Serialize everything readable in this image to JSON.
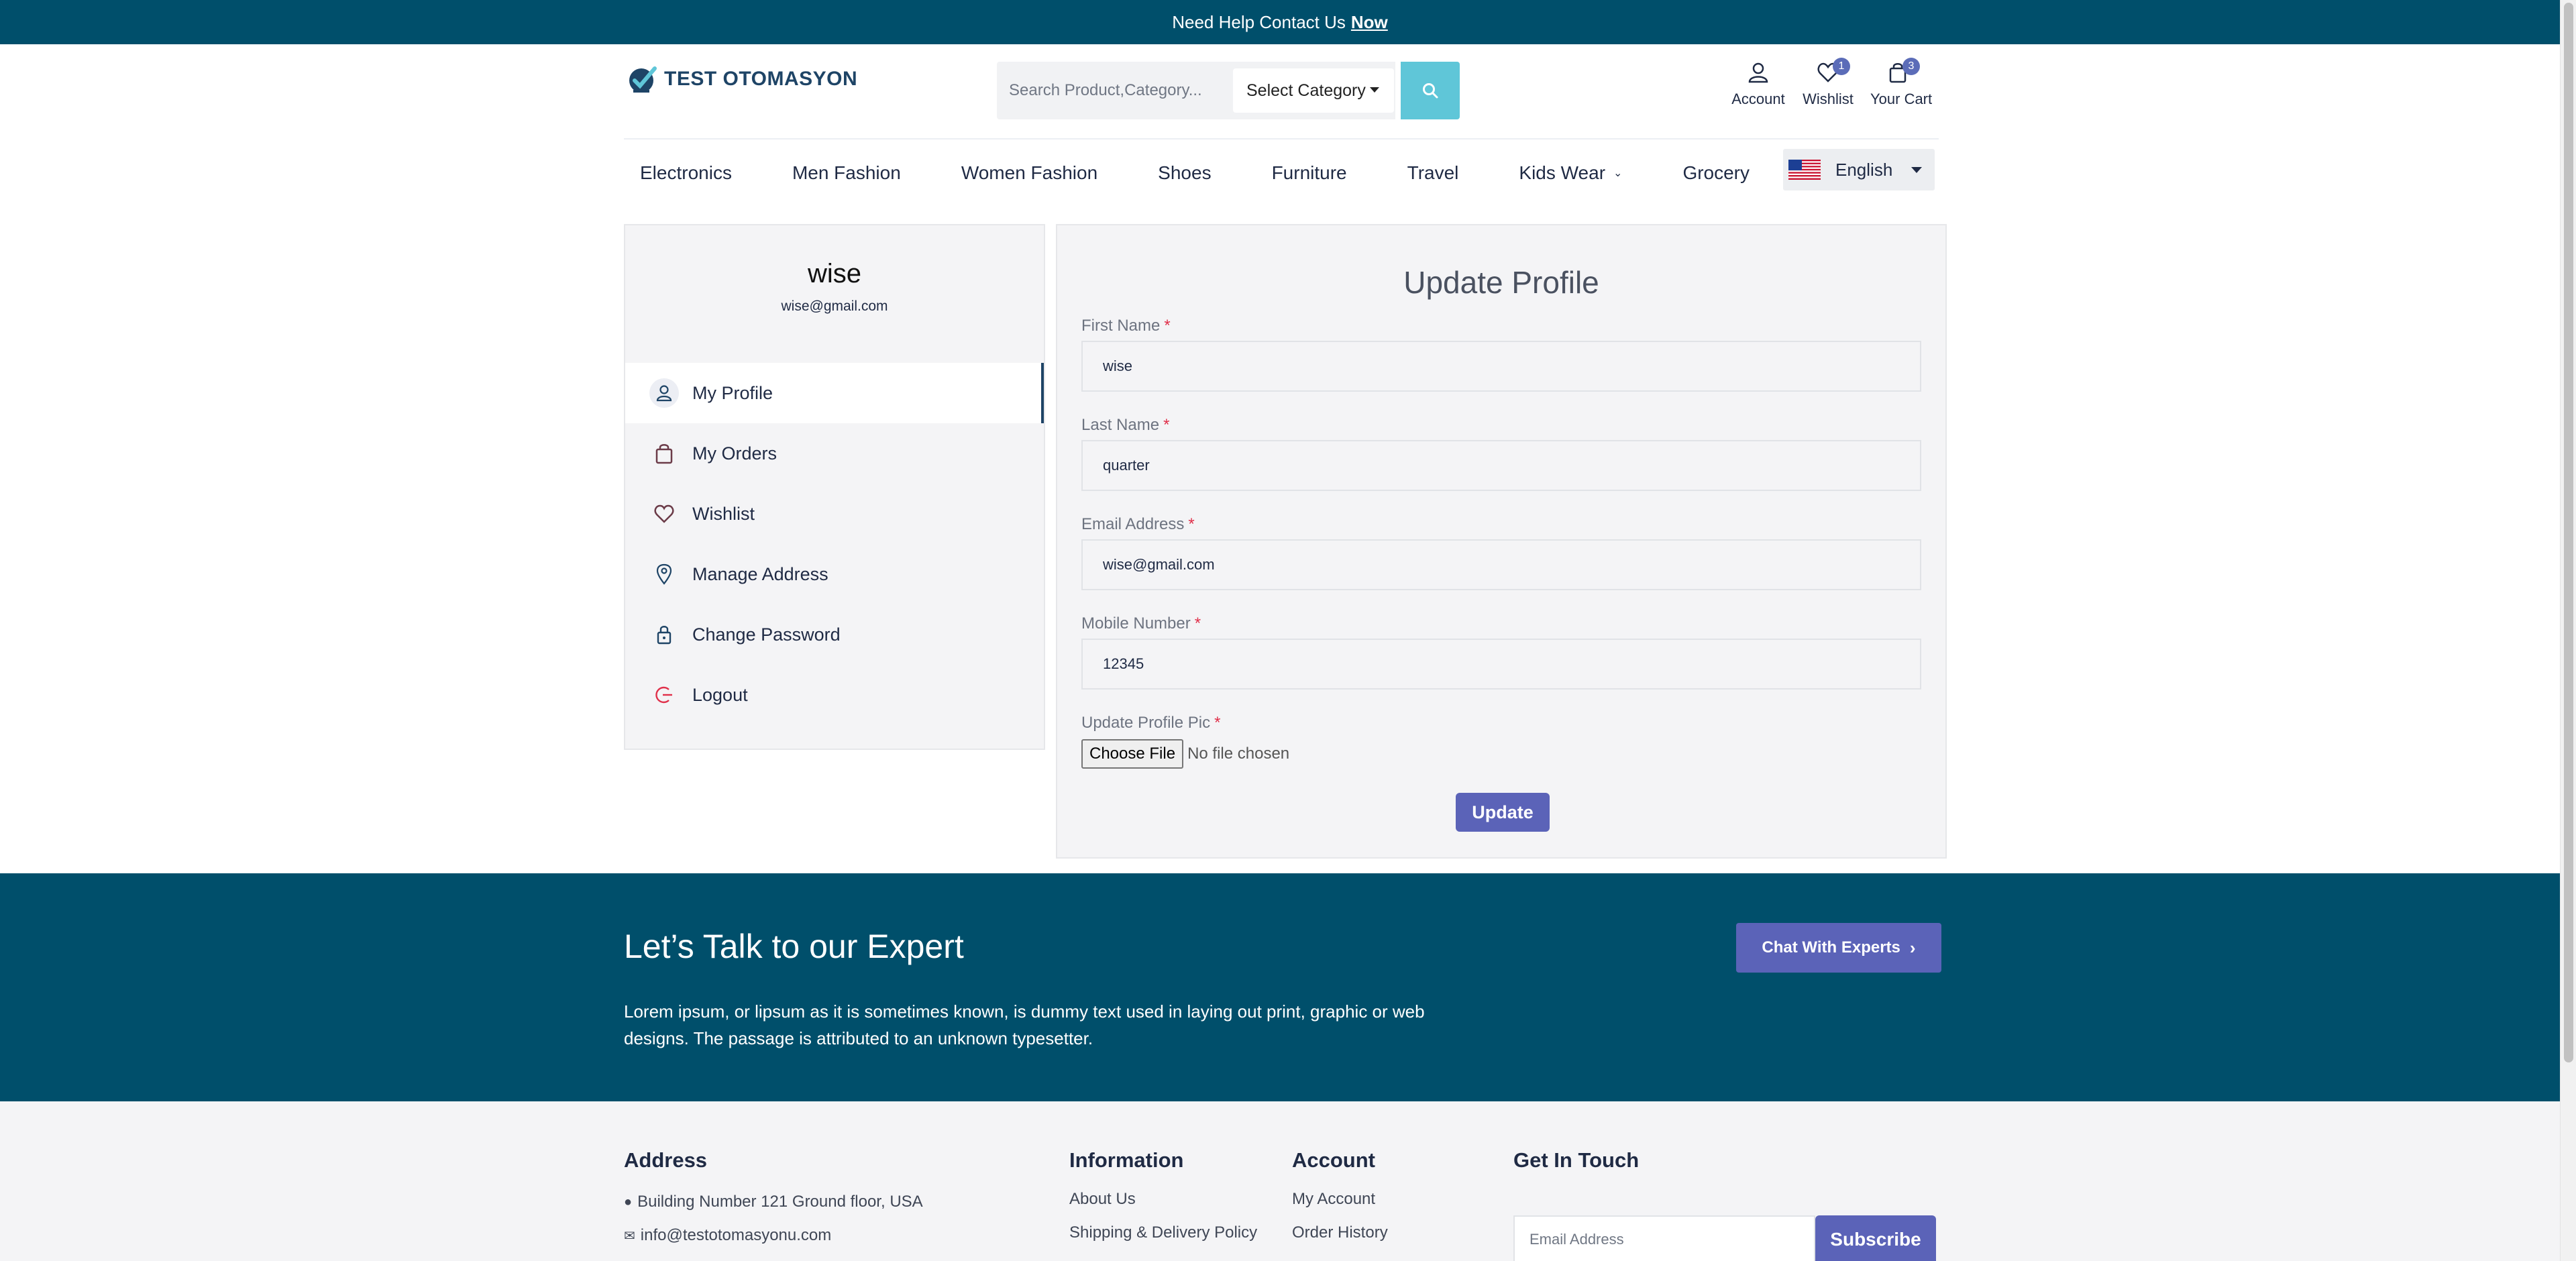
{
  "topbar": {
    "text": "Need Help Contact Us",
    "link": "Now"
  },
  "header": {
    "logo_text": "TEST OTOMASYON",
    "search_placeholder": "Search Product,Category...",
    "category_select": "Select Category",
    "icons": [
      {
        "label": "Account",
        "icon": "user-icon"
      },
      {
        "label": "Wishlist",
        "icon": "heart-icon",
        "badge": "1"
      },
      {
        "label": "Your Cart",
        "icon": "bag-icon",
        "badge": "3"
      }
    ]
  },
  "nav": {
    "items": [
      "Electronics",
      "Men Fashion",
      "Women Fashion",
      "Shoes",
      "Furniture",
      "Travel",
      "Kids Wear",
      "Grocery"
    ],
    "language": "English"
  },
  "sidebar": {
    "username": "wise",
    "email": "wise@gmail.com",
    "menu": [
      {
        "label": "My Profile",
        "icon": "user-icon"
      },
      {
        "label": "My Orders",
        "icon": "bag-icon"
      },
      {
        "label": "Wishlist",
        "icon": "heart-icon"
      },
      {
        "label": "Manage Address",
        "icon": "map-pin-icon"
      },
      {
        "label": "Change Password",
        "icon": "lock-icon"
      },
      {
        "label": "Logout",
        "icon": "logout-icon"
      }
    ]
  },
  "form": {
    "title": "Update Profile",
    "first_name": {
      "label": "First Name",
      "value": "wise"
    },
    "last_name": {
      "label": "Last Name",
      "value": "quarter"
    },
    "email": {
      "label": "Email Address",
      "value": "wise@gmail.com"
    },
    "mobile": {
      "label": "Mobile Number",
      "value": "12345"
    },
    "profile_pic": {
      "label": "Update Profile Pic",
      "button": "Choose File",
      "status": "No file chosen"
    },
    "required_mark": "*",
    "submit": "Update"
  },
  "expert": {
    "title": "Let’s Talk to our Expert",
    "text": "Lorem ipsum, or lipsum as it is sometimes known, is dummy text used in laying out print, graphic or web designs. The passage is attributed to an unknown typesetter.",
    "button": "Chat With Experts"
  },
  "footer": {
    "address": {
      "title": "Address",
      "line1": "Building Number 121 Ground floor, USA",
      "line2": "info@testotomasyonu.com"
    },
    "information": {
      "title": "Information",
      "items": [
        "About Us",
        "Shipping & Delivery Policy"
      ]
    },
    "account": {
      "title": "Account",
      "items": [
        "My Account",
        "Order History"
      ]
    },
    "contact": {
      "title": "Get In Touch",
      "email_placeholder": "Email Address",
      "button": "Subscribe"
    }
  },
  "colors": {
    "primary": "#004f6b",
    "accent": "#5b63b8",
    "search_button": "#5fc6d8",
    "required": "#e0304a"
  }
}
